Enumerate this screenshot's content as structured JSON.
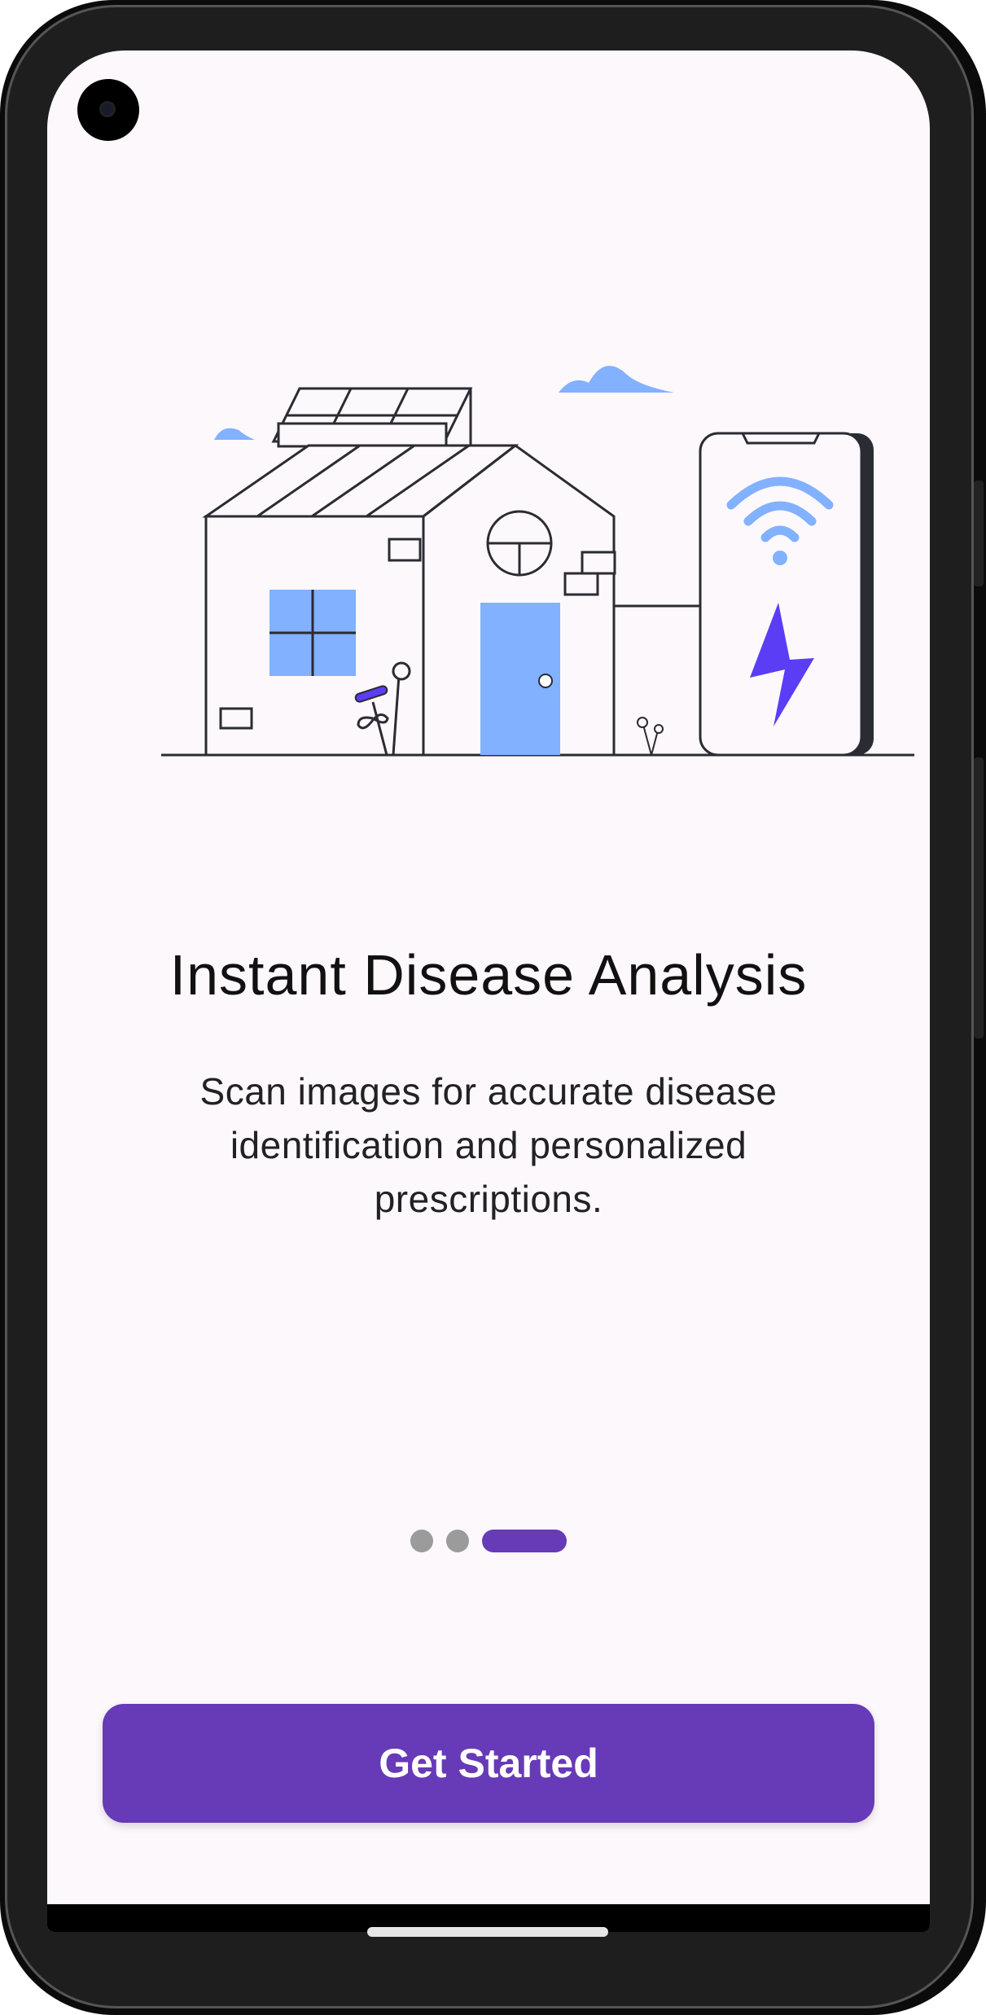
{
  "onboarding": {
    "title": "Instant Disease Analysis",
    "description": "Scan images for accurate disease identification and personalized prescriptions.",
    "page_indicator": {
      "total": 3,
      "current": 3
    },
    "cta_label": "Get Started"
  },
  "colors": {
    "accent": "#673ab7",
    "screen_background": "#fdf8fc",
    "inactive_dot": "#9b9b9b",
    "illustration_blue": "#82b1ff",
    "illustration_purple": "#5b3df5"
  },
  "icons": [
    "front-camera-icon",
    "wifi-icon",
    "lightning-bolt-icon"
  ]
}
